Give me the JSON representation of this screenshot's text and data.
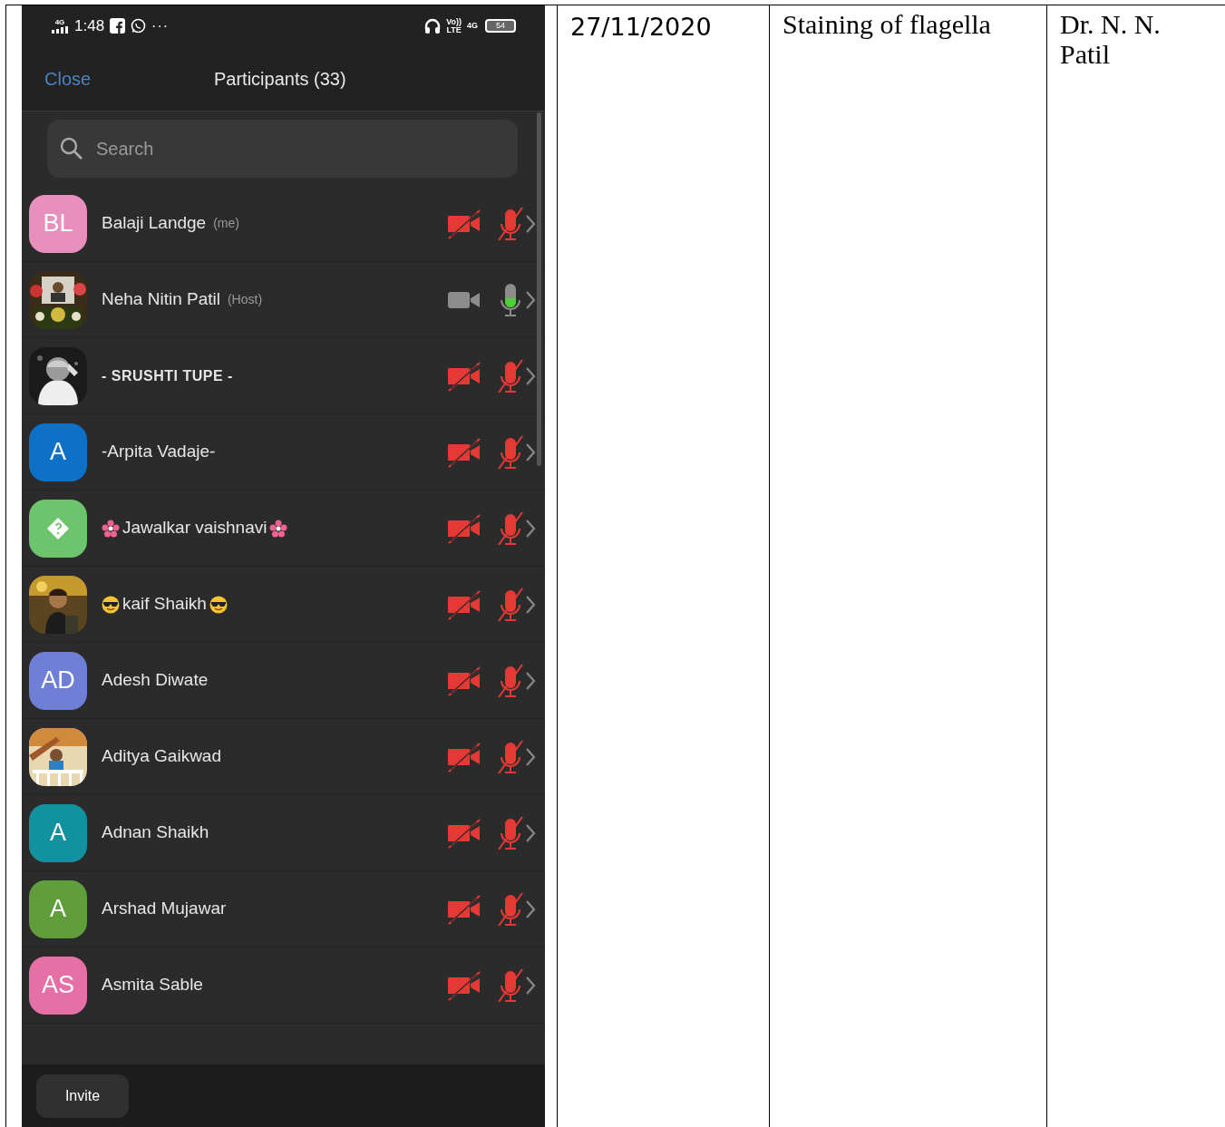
{
  "table": {
    "cells": [
      {
        "kind": "screenshot"
      },
      {
        "kind": "text",
        "text": "27/11/2020"
      },
      {
        "kind": "text",
        "text": "Staining of flagella"
      },
      {
        "kind": "text",
        "text": "Dr. N. N. Patil"
      }
    ]
  },
  "status_bar": {
    "network": "4G",
    "time": "1:48",
    "more": "···",
    "volte": "Vo))",
    "lte": "LTE",
    "data": "4G",
    "battery": "54"
  },
  "header": {
    "close": "Close",
    "title": "Participants (33)"
  },
  "search": {
    "placeholder": "Search"
  },
  "participants": [
    {
      "name": "Balaji Landge",
      "tag": "(me)",
      "kind": "initials",
      "initials": "BL",
      "color": "#e88fbd",
      "video": false,
      "mic": false
    },
    {
      "name": "Neha Nitin Patil",
      "tag": "(Host)",
      "video": true,
      "mic": true
    },
    {
      "name": "- SRUSHTI TUPE -",
      "video": false,
      "mic": false
    },
    {
      "name": "-Arpita Vadaje-",
      "kind": "initials",
      "initials": "A",
      "color": "#0e71c8",
      "video": false,
      "mic": false
    },
    {
      "name": "Jawalkar vaishnavi",
      "kind": "flower",
      "color": "#6cc56c",
      "video": false,
      "mic": false
    },
    {
      "name": "kaif Shaikh",
      "kind": "cool",
      "video": false,
      "mic": false
    },
    {
      "name": "Adesh Diwate",
      "kind": "initials",
      "initials": "AD",
      "color": "#6f7fd6",
      "video": false,
      "mic": false
    },
    {
      "name": "Aditya Gaikwad",
      "video": false,
      "mic": false
    },
    {
      "name": "Adnan Shaikh",
      "kind": "initials",
      "initials": "A",
      "color": "#12919e",
      "video": false,
      "mic": false
    },
    {
      "name": "Arshad Mujawar",
      "kind": "initials",
      "initials": "A",
      "color": "#5f9e3a",
      "video": false,
      "mic": false
    },
    {
      "name": "Asmita Sable",
      "kind": "initials",
      "initials": "AS",
      "color": "#e66fa5",
      "video": false,
      "mic": false
    }
  ],
  "bottom_bar": {
    "invite": "Invite"
  }
}
